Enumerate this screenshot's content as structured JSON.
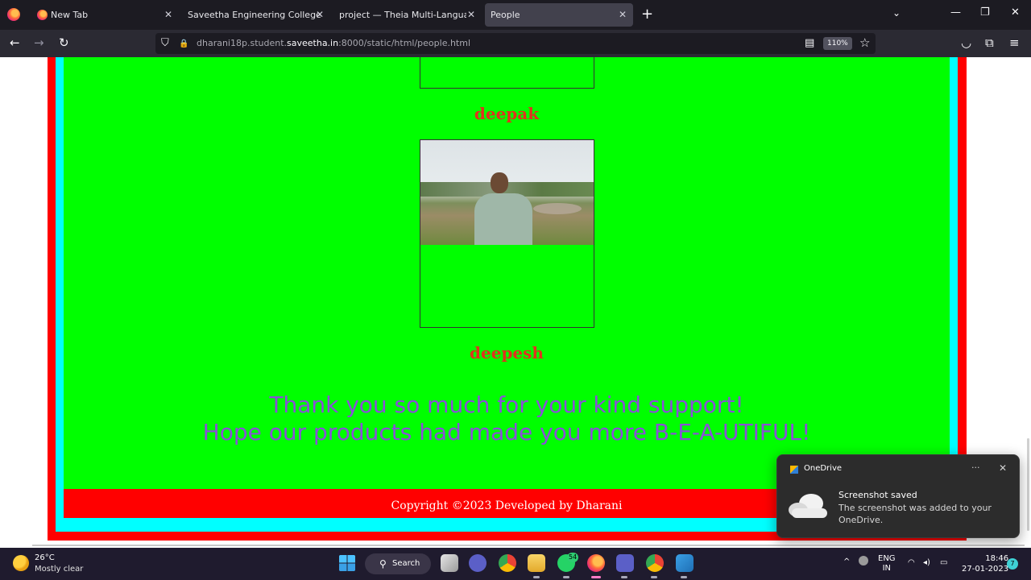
{
  "tabs": [
    {
      "label": "New Tab"
    },
    {
      "label": "Saveetha Engineering College"
    },
    {
      "label": "project — Theia Multi-Language Ex"
    },
    {
      "label": "People"
    }
  ],
  "icons": {
    "close": "✕",
    "new_tab": "+",
    "list_tabs": "⌄",
    "minimize": "—",
    "restore": "❐",
    "window_close": "✕",
    "back": "←",
    "forward": "→",
    "reload": "↻",
    "shield": "⛉",
    "lock": "🔒",
    "reader": "▤",
    "star": "☆",
    "pocket": "◡",
    "extensions": "⧉",
    "menu": "≡",
    "more": "···",
    "search": "⚲",
    "chevron_up": "^",
    "wifi": "◠",
    "speaker": "◂)",
    "battery": "▭"
  },
  "url": {
    "prefix": "dharani18p.student.",
    "domain": "saveetha.in",
    "suffix": ":8000/static/html/people.html"
  },
  "zoom": "110%",
  "page": {
    "people": [
      {
        "name": "deepak"
      },
      {
        "name": "deepesh"
      }
    ],
    "thanks_line1": "Thank you so much for your kind support!",
    "thanks_line2": "Hope our products had made you more B-E-A-UTIFUL!",
    "footer": "Copyright ©2023 Developed by Dharani"
  },
  "toast": {
    "app": "OneDrive",
    "title": "Screenshot saved",
    "body": "The screenshot was added to your OneDrive."
  },
  "taskbar": {
    "temp": "26°C",
    "weather": "Mostly clear",
    "search": "Search",
    "whatsapp_badge": "54",
    "lang1": "ENG",
    "lang2": "IN",
    "time": "18:46",
    "date": "27-01-2023",
    "notifications": "7"
  },
  "colors": {
    "page_green": "#00ff00",
    "frame_red": "#ff0000",
    "frame_cyan": "#00ffff",
    "name_red": "#e0321e",
    "thanks_purple": "#8a4fd8"
  }
}
